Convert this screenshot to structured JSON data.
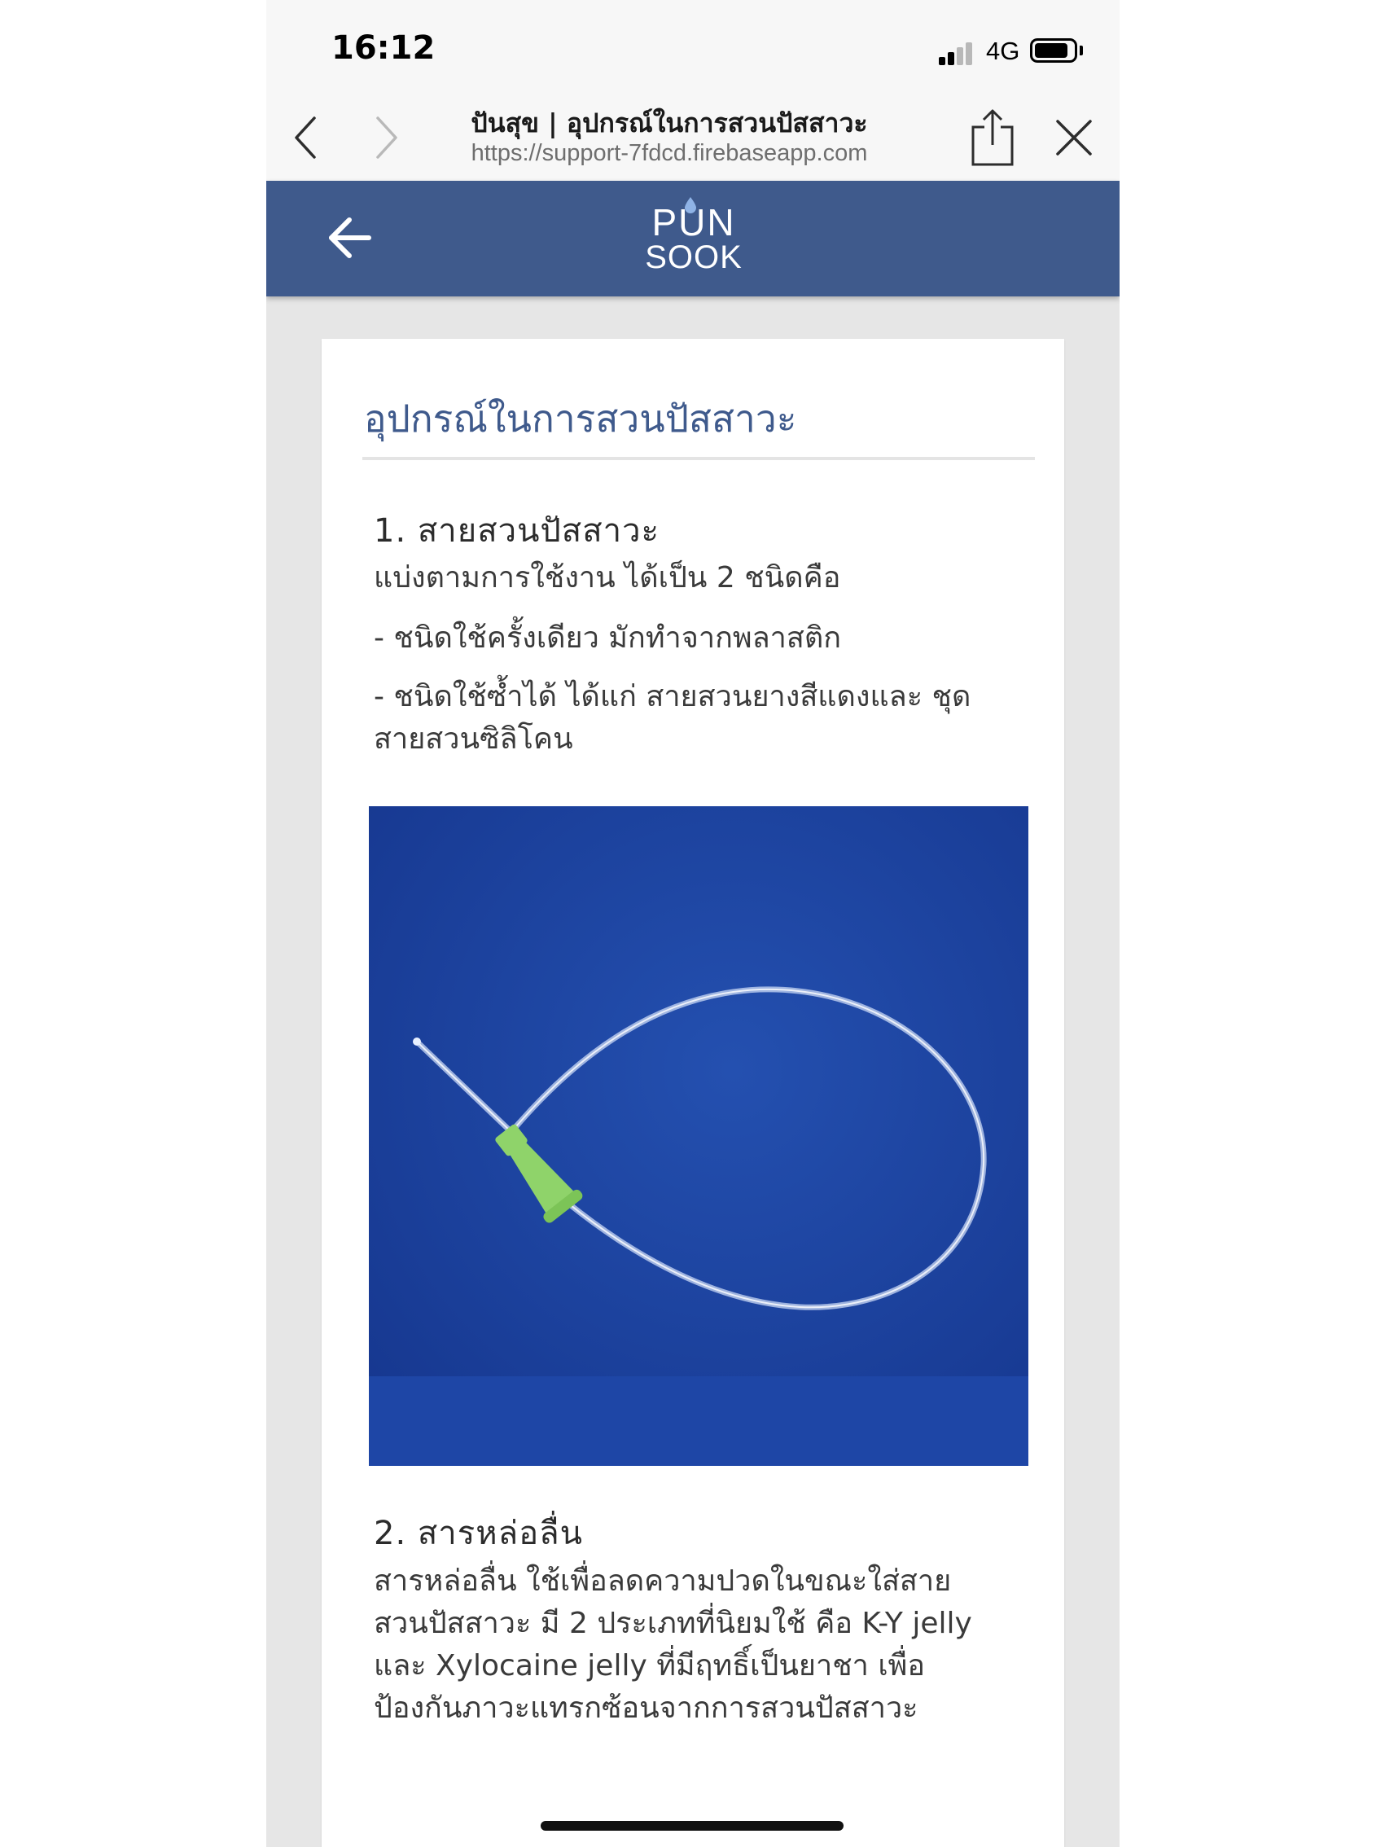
{
  "status_bar": {
    "time": "16:12",
    "network": "4G"
  },
  "browser": {
    "page_title": "ปันสุข | อุปกรณ์ในการสวนปัสสาวะ",
    "url": "https://support-7fdcd.firebaseapp.com"
  },
  "app_header": {
    "logo_top": "PUN",
    "logo_bottom": "SOOK"
  },
  "content": {
    "title": "อุปกรณ์ในการสวนปัสสาวะ",
    "section1": {
      "heading": "1. สายสวนปัสสาวะ",
      "intro": "แบ่งตามการใช้งาน ได้เป็น 2 ชนิดคือ",
      "item1": "- ชนิดใช้ครั้งเดียว มักทำจากพลาสติก",
      "item2_line1": "- ชนิดใช้ซ้ำได้ ได้แก่ สายสวนยางสีแดงและ ชุด",
      "item2_line2": "สายสวนซิลิโคน"
    },
    "section2": {
      "heading": "2. สารหล่อลื่น",
      "line1": "สารหล่อลื่น ใช้เพื่อลดความปวดในขณะใส่สาย",
      "line2": "สวนปัสสาวะ มี 2 ประเภทที่นิยมใช้ คือ K-Y jelly",
      "line3": "และ Xylocaine jelly ที่มีฤทธิ์เป็นยาชา เพื่อ",
      "line4": "ป้องกันภาวะแทรกซ้อนจากการสวนปัสสาวะ"
    }
  },
  "colors": {
    "header_bg": "#3f5a8c",
    "title_color": "#3f5a8c",
    "image_bg": "#1a3f9c",
    "catheter_funnel": "#8fd36a"
  },
  "icons": {
    "back": "chevron-left-icon",
    "forward": "chevron-right-icon",
    "share": "share-icon",
    "close": "close-icon",
    "app_back": "arrow-left-icon"
  }
}
